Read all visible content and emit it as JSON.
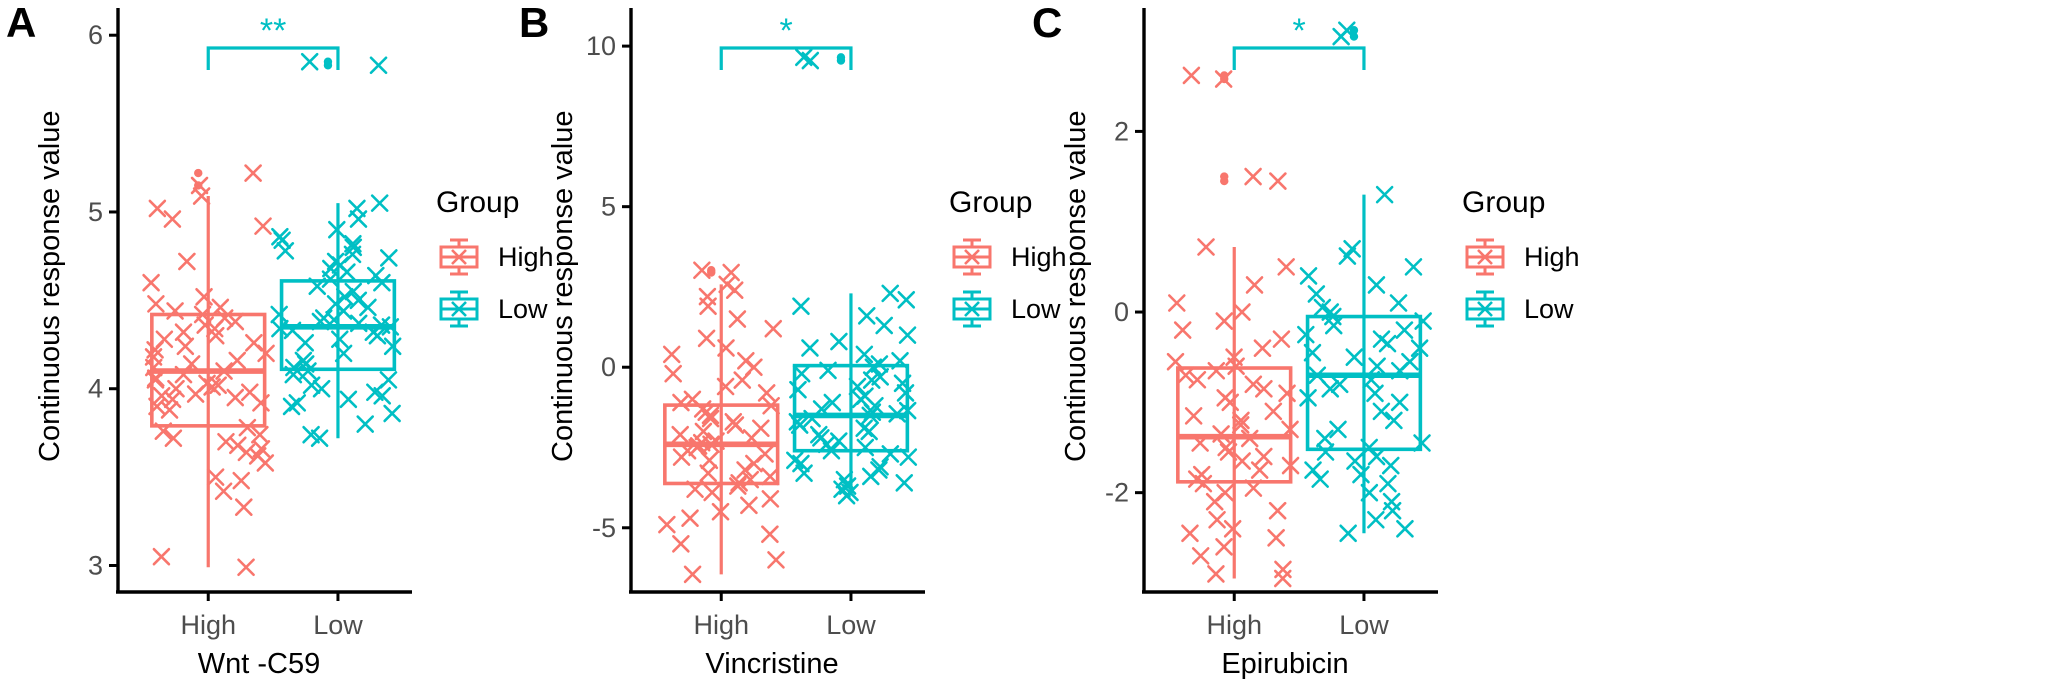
{
  "figure": {
    "background": "#ffffff",
    "colors": {
      "high": "#F8766D",
      "low": "#00BFC4",
      "axis": "#000000",
      "tick_text": "#4d4d4d"
    }
  },
  "panels": [
    {
      "letter": "A",
      "ylabel": "Continuous response value",
      "xlabel": "Wnt -C59",
      "legend": {
        "title": "Group",
        "items": [
          {
            "label": "High",
            "color": "#F8766D"
          },
          {
            "label": "Low",
            "color": "#00BFC4"
          }
        ]
      },
      "significance": {
        "symbol": "**"
      },
      "chart_data": {
        "type": "box",
        "title": "Wnt -C59",
        "xlabel": "Wnt -C59",
        "ylabel": "Continuous response value",
        "categories": [
          "High",
          "Low"
        ],
        "yticks": [
          3,
          4,
          5,
          6
        ],
        "ylim": [
          2.85,
          6.12
        ],
        "grid": false,
        "legend_position": "right",
        "annotation": "**",
        "series": [
          {
            "name": "High",
            "color": "#F8766D",
            "box": {
              "min": 2.99,
              "q1": 3.79,
              "median": 4.1,
              "q3": 4.42,
              "max": 5.09
            },
            "outliers": [
              5.15,
              5.22
            ],
            "points": [
              2.99,
              3.05,
              3.33,
              3.42,
              3.48,
              3.5,
              3.58,
              3.62,
              3.64,
              3.66,
              3.68,
              3.7,
              3.72,
              3.74,
              3.76,
              3.78,
              3.88,
              3.9,
              3.92,
              3.94,
              3.95,
              3.96,
              3.97,
              3.98,
              4.0,
              4.01,
              4.02,
              4.03,
              4.05,
              4.06,
              4.08,
              4.1,
              4.12,
              4.14,
              4.16,
              4.18,
              4.2,
              4.22,
              4.24,
              4.26,
              4.28,
              4.3,
              4.32,
              4.34,
              4.36,
              4.38,
              4.4,
              4.42,
              4.44,
              4.46,
              4.48,
              4.52,
              4.6,
              4.72,
              4.92,
              4.96,
              5.02,
              5.09,
              5.15,
              5.22
            ]
          },
          {
            "name": "Low",
            "color": "#00BFC4",
            "box": {
              "min": 3.72,
              "q1": 4.11,
              "median": 4.35,
              "q3": 4.61,
              "max": 5.05
            },
            "outliers": [
              5.83,
              5.85
            ],
            "points": [
              3.72,
              3.74,
              3.8,
              3.86,
              3.9,
              3.92,
              3.94,
              3.96,
              3.98,
              4.0,
              4.02,
              4.05,
              4.08,
              4.1,
              4.12,
              4.14,
              4.16,
              4.2,
              4.24,
              4.26,
              4.28,
              4.3,
              4.32,
              4.33,
              4.34,
              4.35,
              4.36,
              4.37,
              4.38,
              4.39,
              4.4,
              4.42,
              4.44,
              4.46,
              4.48,
              4.5,
              4.52,
              4.55,
              4.58,
              4.6,
              4.62,
              4.64,
              4.66,
              4.68,
              4.7,
              4.72,
              4.74,
              4.76,
              4.78,
              4.8,
              4.82,
              4.84,
              4.86,
              4.9,
              4.96,
              5.02,
              5.05,
              5.83,
              5.85
            ]
          }
        ]
      }
    },
    {
      "letter": "B",
      "ylabel": "Continuous response value",
      "xlabel": "Vincristine",
      "legend": {
        "title": "Group",
        "items": [
          {
            "label": "High",
            "color": "#F8766D"
          },
          {
            "label": "Low",
            "color": "#00BFC4"
          }
        ]
      },
      "significance": {
        "symbol": "*"
      },
      "chart_data": {
        "type": "box",
        "title": "Vincristine",
        "xlabel": "Vincristine",
        "ylabel": "Continuous response value",
        "categories": [
          "High",
          "Low"
        ],
        "yticks": [
          -5,
          0,
          5,
          10
        ],
        "ylim": [
          -7.0,
          11.0
        ],
        "grid": false,
        "legend_position": "right",
        "annotation": "*",
        "series": [
          {
            "name": "High",
            "color": "#F8766D",
            "box": {
              "min": -6.45,
              "q1": -3.62,
              "median": -2.4,
              "q3": -1.18,
              "max": 2.58
            },
            "outliers": [
              2.95,
              3.02
            ],
            "points": [
              -6.45,
              -6.0,
              -5.5,
              -5.2,
              -4.9,
              -4.7,
              -4.5,
              -4.3,
              -4.1,
              -3.9,
              -3.8,
              -3.7,
              -3.6,
              -3.5,
              -3.4,
              -3.3,
              -3.2,
              -3.0,
              -2.9,
              -2.8,
              -2.7,
              -2.6,
              -2.5,
              -2.45,
              -2.4,
              -2.35,
              -2.3,
              -2.2,
              -2.1,
              -2.0,
              -1.9,
              -1.8,
              -1.7,
              -1.6,
              -1.5,
              -1.4,
              -1.3,
              -1.2,
              -1.1,
              -1.0,
              -0.8,
              -0.6,
              -0.4,
              -0.2,
              0.0,
              0.2,
              0.4,
              0.6,
              0.9,
              1.2,
              1.5,
              1.9,
              2.2,
              2.4,
              2.58,
              2.95,
              3.02
            ]
          },
          {
            "name": "Low",
            "color": "#00BFC4",
            "box": {
              "min": -4.0,
              "q1": -2.6,
              "median": -1.5,
              "q3": 0.05,
              "max": 2.3
            },
            "outliers": [
              9.55,
              9.65
            ],
            "points": [
              -4.0,
              -3.9,
              -3.8,
              -3.7,
              -3.6,
              -3.5,
              -3.4,
              -3.3,
              -3.2,
              -3.1,
              -3.0,
              -2.9,
              -2.8,
              -2.7,
              -2.6,
              -2.5,
              -2.4,
              -2.3,
              -2.2,
              -2.1,
              -2.0,
              -1.9,
              -1.8,
              -1.7,
              -1.6,
              -1.5,
              -1.45,
              -1.4,
              -1.35,
              -1.3,
              -1.2,
              -1.1,
              -1.0,
              -0.9,
              -0.8,
              -0.7,
              -0.6,
              -0.5,
              -0.4,
              -0.3,
              -0.2,
              -0.1,
              0.0,
              0.1,
              0.2,
              0.4,
              0.6,
              0.8,
              1.0,
              1.3,
              1.6,
              1.9,
              2.1,
              2.3,
              9.55,
              9.65
            ]
          }
        ]
      }
    },
    {
      "letter": "C",
      "ylabel": "Continuous response value",
      "xlabel": "Epirubicin",
      "legend": {
        "title": "Group",
        "items": [
          {
            "label": "High",
            "color": "#F8766D"
          },
          {
            "label": "Low",
            "color": "#00BFC4"
          }
        ]
      },
      "significance": {
        "symbol": "*"
      },
      "chart_data": {
        "type": "box",
        "title": "Epirubicin",
        "xlabel": "Epirubicin",
        "ylabel": "Continuous response value",
        "categories": [
          "High",
          "Low"
        ],
        "yticks": [
          -2,
          0,
          2
        ],
        "ylim": [
          -3.1,
          3.3
        ],
        "grid": false,
        "legend_position": "right",
        "annotation": "*",
        "series": [
          {
            "name": "High",
            "color": "#F8766D",
            "box": {
              "min": -2.95,
              "q1": -1.88,
              "median": -1.38,
              "q3": -0.62,
              "max": 0.72
            },
            "outliers": [
              1.45,
              1.5,
              2.58,
              2.62
            ],
            "points": [
              -2.95,
              -2.9,
              -2.85,
              -2.7,
              -2.6,
              -2.5,
              -2.45,
              -2.4,
              -2.3,
              -2.2,
              -2.1,
              -2.0,
              -1.95,
              -1.9,
              -1.85,
              -1.8,
              -1.75,
              -1.7,
              -1.65,
              -1.6,
              -1.55,
              -1.5,
              -1.45,
              -1.4,
              -1.35,
              -1.3,
              -1.25,
              -1.2,
              -1.15,
              -1.1,
              -1.0,
              -0.95,
              -0.9,
              -0.85,
              -0.8,
              -0.75,
              -0.7,
              -0.65,
              -0.6,
              -0.55,
              -0.5,
              -0.4,
              -0.3,
              -0.2,
              -0.1,
              0.0,
              0.1,
              0.3,
              0.5,
              0.72,
              1.45,
              1.5,
              2.58,
              2.62
            ]
          },
          {
            "name": "Low",
            "color": "#00BFC4",
            "box": {
              "min": -2.45,
              "q1": -1.52,
              "median": -0.7,
              "q3": -0.05,
              "max": 1.3
            },
            "outliers": [
              3.05,
              3.12
            ],
            "points": [
              -2.45,
              -2.4,
              -2.3,
              -2.2,
              -2.1,
              -2.0,
              -1.9,
              -1.85,
              -1.8,
              -1.75,
              -1.7,
              -1.65,
              -1.6,
              -1.55,
              -1.5,
              -1.45,
              -1.4,
              -1.3,
              -1.2,
              -1.1,
              -1.0,
              -0.95,
              -0.9,
              -0.85,
              -0.8,
              -0.75,
              -0.7,
              -0.65,
              -0.6,
              -0.55,
              -0.5,
              -0.45,
              -0.4,
              -0.35,
              -0.3,
              -0.25,
              -0.2,
              -0.15,
              -0.1,
              -0.05,
              0.0,
              0.05,
              0.1,
              0.2,
              0.3,
              0.4,
              0.5,
              0.62,
              0.7,
              1.3,
              3.05,
              3.12
            ]
          }
        ]
      }
    }
  ]
}
